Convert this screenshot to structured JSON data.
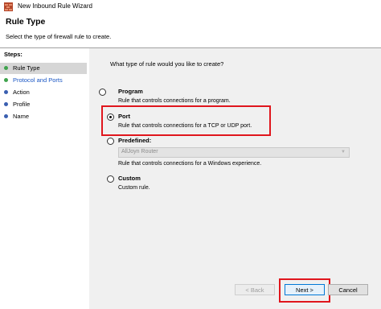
{
  "window": {
    "title": "New Inbound Rule Wizard"
  },
  "header": {
    "title": "Rule Type",
    "description": "Select the type of firewall rule to create."
  },
  "steps": {
    "label": "Steps:",
    "items": [
      {
        "label": "Rule Type",
        "color": "#3fa34d"
      },
      {
        "label": "Protocol and Ports",
        "color": "#3fa34d"
      },
      {
        "label": "Action",
        "color": "#3a5fb0"
      },
      {
        "label": "Profile",
        "color": "#3a5fb0"
      },
      {
        "label": "Name",
        "color": "#3a5fb0"
      }
    ]
  },
  "main": {
    "question": "What type of rule would you like to create?",
    "options": [
      {
        "label": "Program",
        "description": "Rule that controls connections for a program.",
        "checked": false
      },
      {
        "label": "Port",
        "description": "Rule that controls connections for a TCP or UDP port.",
        "checked": true
      },
      {
        "label": "Predefined:",
        "description": "Rule that controls connections for a Windows experience.",
        "checked": false
      },
      {
        "label": "Custom",
        "description": "Custom rule.",
        "checked": false
      }
    ],
    "predefined_select": {
      "value": "AllJoyn Router"
    }
  },
  "buttons": {
    "back": "< Back",
    "next": "Next >",
    "cancel": "Cancel"
  },
  "colors": {
    "highlight": "#e0161d",
    "accent": "#0078d7"
  }
}
